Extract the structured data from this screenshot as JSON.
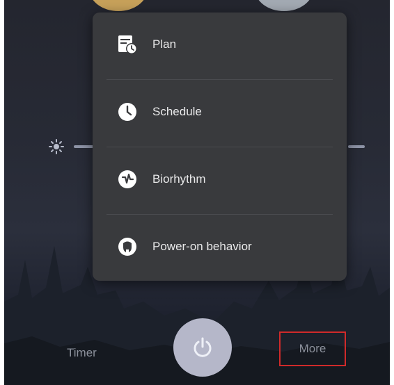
{
  "menu": {
    "items": [
      {
        "label": "Plan",
        "icon": "calendar-clock-icon"
      },
      {
        "label": "Schedule",
        "icon": "clock-icon"
      },
      {
        "label": "Biorhythm",
        "icon": "biorhythm-icon"
      },
      {
        "label": "Power-on behavior",
        "icon": "power-on-behavior-icon"
      }
    ]
  },
  "bottom_bar": {
    "timer_label": "Timer",
    "power_icon": "power-icon",
    "more_label": "More",
    "more_highlight_color": "#d02a2a"
  },
  "colors": {
    "menu_background": "#393a3d",
    "warm_preset": "#c7a15a",
    "cool_preset": "#a3aab3"
  }
}
